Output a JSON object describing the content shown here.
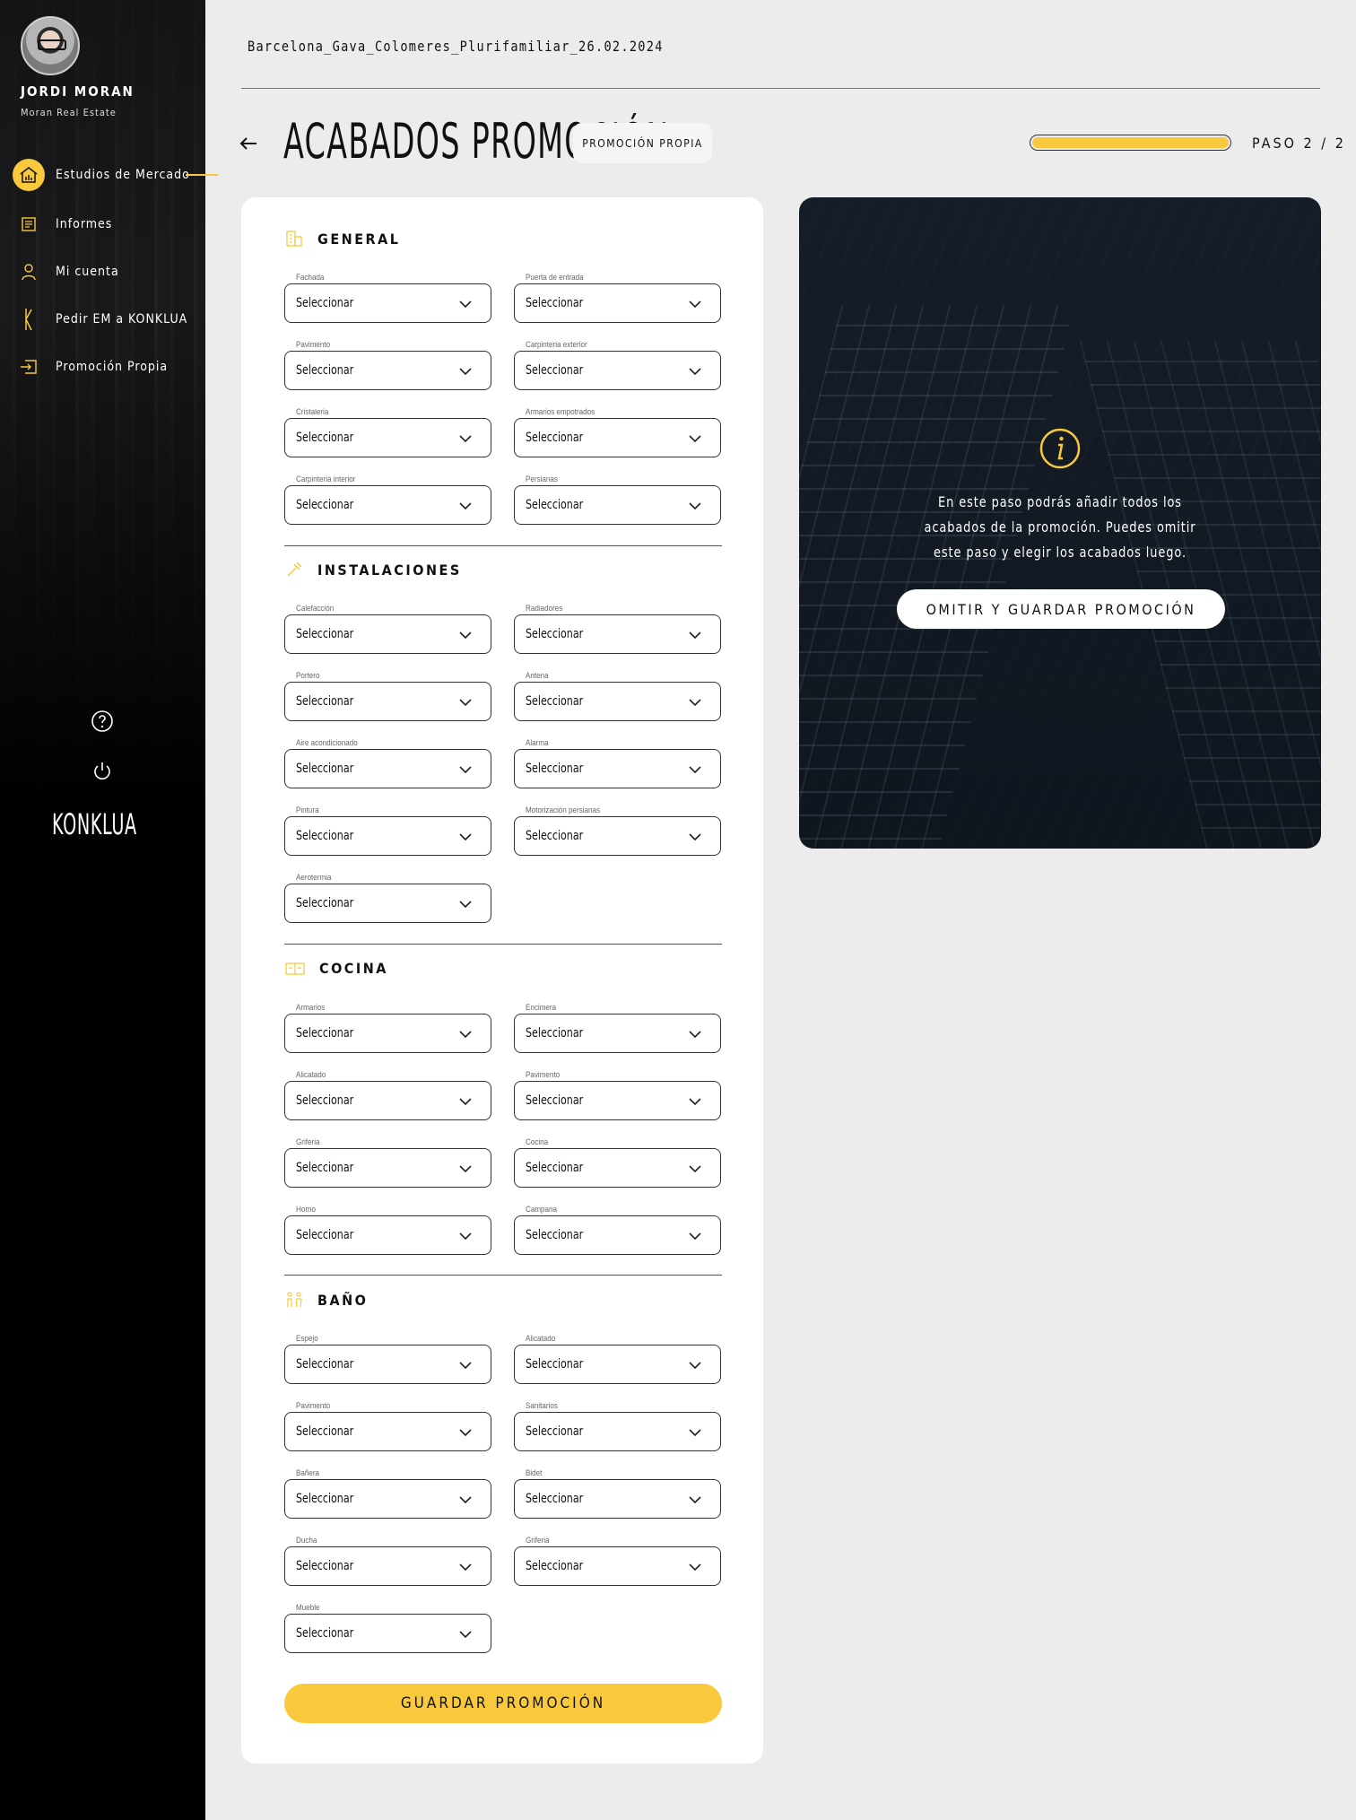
{
  "user": {
    "name": "JORDI MORAN",
    "company": "Moran Real Estate"
  },
  "nav": [
    {
      "label": "Estudios de Mercado",
      "icon": "home-chart-icon",
      "active": true
    },
    {
      "label": "Informes",
      "icon": "report-icon"
    },
    {
      "label": "Mi cuenta",
      "icon": "user-icon"
    },
    {
      "label": "Pedir EM a KONKLUA",
      "icon": "konklua-k-icon"
    },
    {
      "label": "Promoción Propia",
      "icon": "promotion-icon"
    }
  ],
  "logo": "KONKLUA",
  "header": {
    "file_name": "Barcelona_Gava_Colomeres_Plurifamiliar_26.02.2024",
    "title": "ACABADOS PROMOCIÓN",
    "badge": "PROMOCIÓN PROPIA",
    "step": "PASO 2 / 2",
    "progress": 1.0
  },
  "select_placeholder": "Seleccionar",
  "sections": [
    {
      "title": "GENERAL",
      "icon": "building-icon",
      "fields": [
        "Fachada",
        "Puerta de entrada",
        "Pavimento",
        "Carpinteria exterior",
        "Cristaleria",
        "Armarios empotrados",
        "Carpinteria interior",
        "Persianas"
      ]
    },
    {
      "title": "INSTALACIONES",
      "icon": "tools-icon",
      "fields": [
        "Calefacción",
        "Radiadores",
        "Portero",
        "Antena",
        "Aire acondicionado",
        "Alarma",
        "Pintura",
        "Motorización persianas",
        "Aerotermia"
      ]
    },
    {
      "title": "COCINA",
      "icon": "kitchen-icon",
      "fields": [
        "Armarios",
        "Encimera",
        "Alicatado",
        "Pavimento",
        "Griferia",
        "Cocina",
        "Horno",
        "Campana"
      ]
    },
    {
      "title": "BAÑO",
      "icon": "bathroom-icon",
      "fields": [
        "Espejo",
        "Alicatado",
        "Pavimento",
        "Sanitarios",
        "Bañera",
        "Bidet",
        "Ducha",
        "Griferia",
        "Mueble"
      ]
    }
  ],
  "save_button": "GUARDAR PROMOCIÓN",
  "info": {
    "text": "En este paso podrás añadir todos los acabados de la promoción. Puedes omitir este paso y elegir los acabados luego.",
    "skip_button": "OMITIR Y GUARDAR PROMOCIÓN"
  },
  "colors": {
    "accent": "#f8c93d",
    "sidebar": "#000000",
    "background": "#ececec"
  }
}
